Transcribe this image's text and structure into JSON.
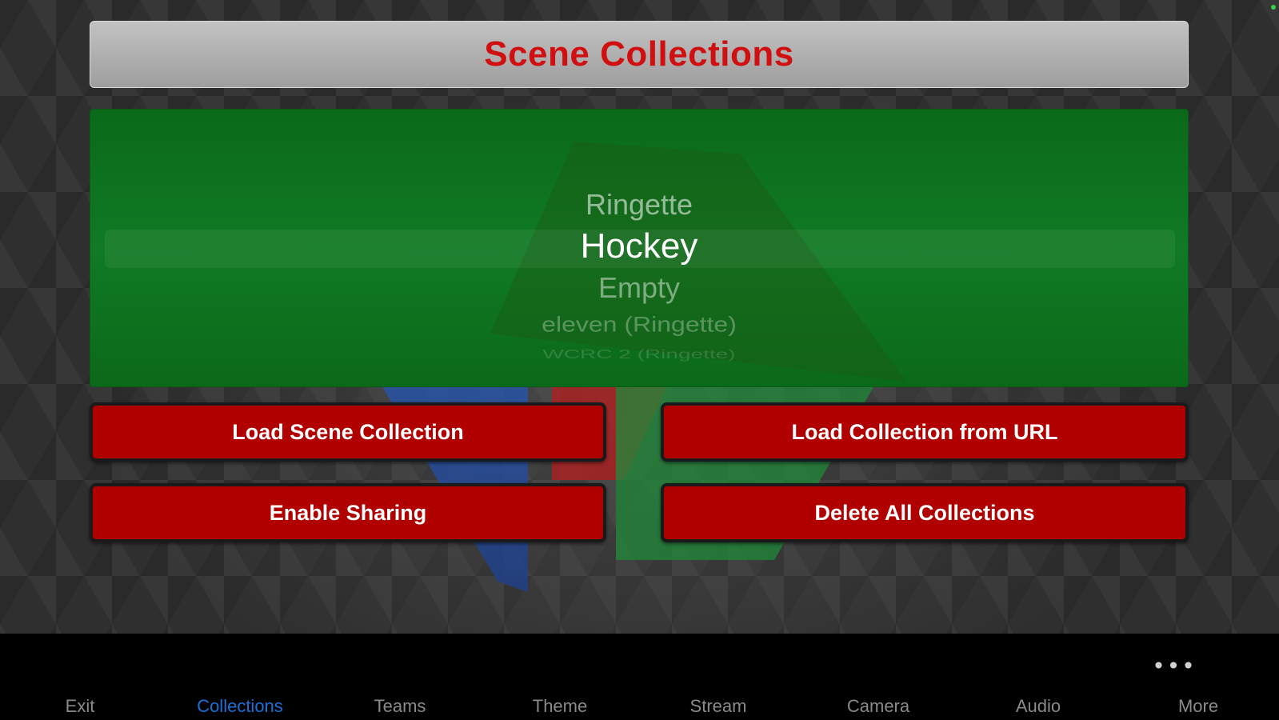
{
  "header": {
    "title": "Scene Collections"
  },
  "picker": {
    "rows": [
      "Ringette",
      "Hockey",
      "Empty",
      "eleven (Ringette)",
      "WCRC 2 (Ringette)"
    ],
    "selected": "Hockey"
  },
  "buttons": {
    "load_scene": "Load Scene Collection",
    "load_url": "Load Collection from URL",
    "enable_sharing": "Enable Sharing",
    "delete_all": "Delete All Collections"
  },
  "tabbar": {
    "more_dots": "•••",
    "items": [
      {
        "label": "Exit"
      },
      {
        "label": "Collections",
        "active": true
      },
      {
        "label": "Teams"
      },
      {
        "label": "Theme"
      },
      {
        "label": "Stream"
      },
      {
        "label": "Camera"
      },
      {
        "label": "Audio"
      },
      {
        "label": "More"
      }
    ]
  },
  "colors": {
    "title": "#d01010",
    "button": "#b00000",
    "picker": "#107a24",
    "active_tab": "#1e6fd8"
  }
}
